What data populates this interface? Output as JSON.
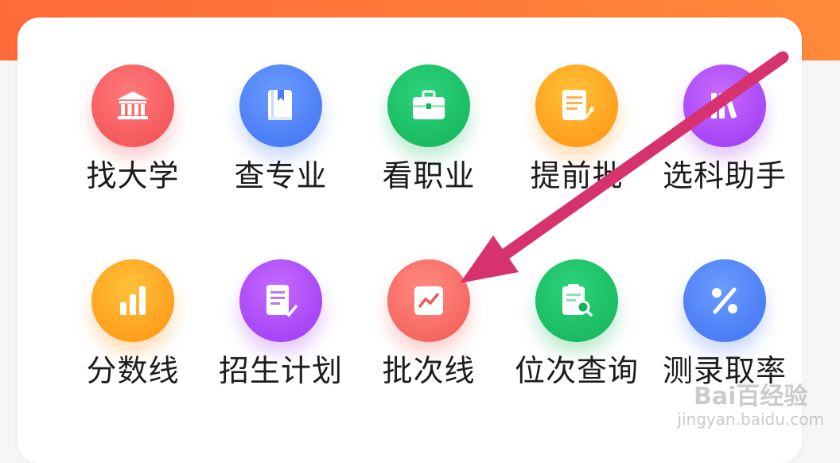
{
  "menu": {
    "row1": [
      {
        "label": "找大学",
        "icon": "university-icon"
      },
      {
        "label": "查专业",
        "icon": "book-icon"
      },
      {
        "label": "看职业",
        "icon": "briefcase-icon"
      },
      {
        "label": "提前批",
        "icon": "document-chart-icon"
      },
      {
        "label": "选科助手",
        "icon": "books-icon"
      }
    ],
    "row2": [
      {
        "label": "分数线",
        "icon": "bar-chart-icon"
      },
      {
        "label": "招生计划",
        "icon": "document-check-icon"
      },
      {
        "label": "批次线",
        "icon": "line-chart-icon"
      },
      {
        "label": "位次查询",
        "icon": "clipboard-search-icon"
      },
      {
        "label": "测录取率",
        "icon": "percent-icon"
      }
    ]
  },
  "colors": {
    "header": "#ff6a3a",
    "arrow": "#d6336e",
    "red": "#f04d52",
    "blue": "#3f71f2",
    "green": "#14b25a",
    "orange": "#ff9112",
    "purple": "#9a37f2"
  },
  "watermark": {
    "brand": "Bai百经验",
    "url": "jingyan.baidu.com"
  }
}
